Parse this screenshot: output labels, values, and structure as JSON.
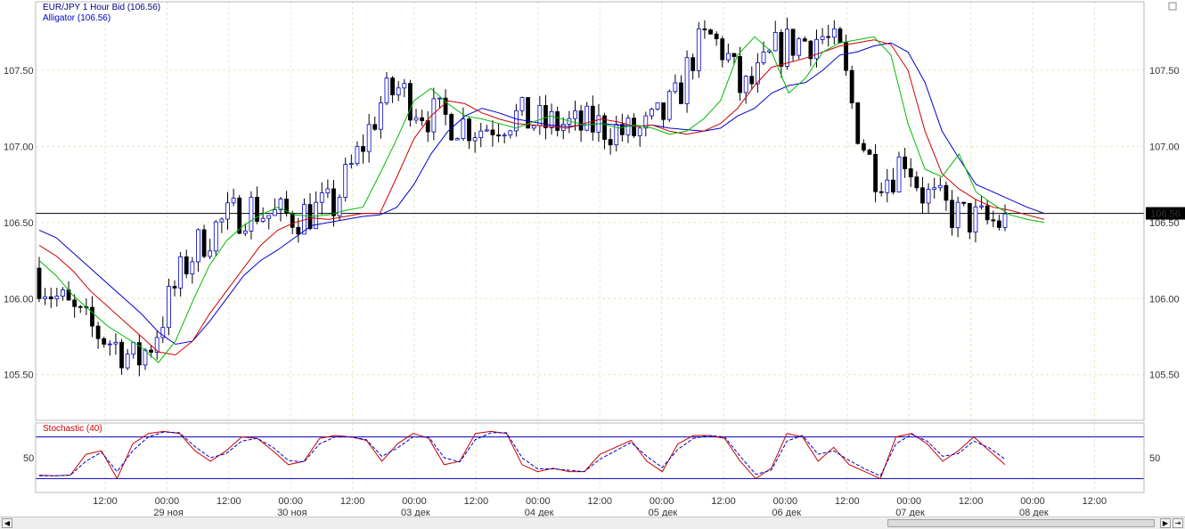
{
  "chart_data": [
    {
      "type": "candlestick",
      "title": "EUR/JPY 1 Hour Bid (106.56)",
      "subtitle": "Alligator (106.56)",
      "ylim": [
        105.2,
        107.95
      ],
      "yticks": [
        "105.50",
        "106.00",
        "106.50",
        "107.00",
        "107.50"
      ],
      "last_price": 106.56,
      "last_price_label": "106.56",
      "series": [
        {
          "name": "Jaw",
          "color": "#0000cc",
          "values": [
            106.45,
            106.4,
            106.3,
            106.2,
            106.1,
            106.0,
            105.9,
            105.78,
            105.7,
            105.72,
            105.85,
            106.0,
            106.15,
            106.25,
            106.32,
            106.4,
            106.48,
            106.5,
            106.52,
            106.54,
            106.55,
            106.6,
            106.75,
            106.95,
            107.1,
            107.2,
            107.25,
            107.22,
            107.18,
            107.16,
            107.14,
            107.13,
            107.14,
            107.15,
            107.14,
            107.13,
            107.14,
            107.12,
            107.11,
            107.1,
            107.12,
            107.2,
            107.25,
            107.35,
            107.4,
            107.42,
            107.5,
            107.6,
            107.62,
            107.66,
            107.68,
            107.62,
            107.42,
            107.1,
            106.92,
            106.75,
            106.7,
            106.65,
            106.6,
            106.56
          ]
        },
        {
          "name": "Teeth",
          "color": "#cc0000",
          "values": [
            106.35,
            106.28,
            106.18,
            106.05,
            105.95,
            105.85,
            105.75,
            105.65,
            105.63,
            105.72,
            105.9,
            106.05,
            106.2,
            106.35,
            106.45,
            106.5,
            106.53,
            106.52,
            106.54,
            106.56,
            106.56,
            106.8,
            107.05,
            107.2,
            107.3,
            107.28,
            107.22,
            107.18,
            107.15,
            107.14,
            107.13,
            107.12,
            107.15,
            107.18,
            107.16,
            107.13,
            107.14,
            107.1,
            107.08,
            107.1,
            107.15,
            107.25,
            107.4,
            107.52,
            107.55,
            107.58,
            107.62,
            107.66,
            107.68,
            107.7,
            107.67,
            107.5,
            107.1,
            106.82,
            106.72,
            106.65,
            106.6,
            106.58,
            106.55,
            106.52
          ]
        },
        {
          "name": "Lips",
          "color": "#00bb00",
          "values": [
            106.25,
            106.15,
            106.02,
            105.92,
            105.82,
            105.75,
            105.68,
            105.58,
            105.72,
            105.98,
            106.22,
            106.38,
            106.48,
            106.55,
            106.6,
            106.55,
            106.54,
            106.55,
            106.58,
            106.6,
            106.82,
            107.05,
            107.3,
            107.38,
            107.28,
            107.2,
            107.18,
            107.15,
            107.12,
            107.16,
            107.2,
            107.17,
            107.14,
            107.15,
            107.12,
            107.14,
            107.12,
            107.08,
            107.1,
            107.18,
            107.3,
            107.6,
            107.72,
            107.62,
            107.35,
            107.45,
            107.62,
            107.68,
            107.7,
            107.72,
            107.6,
            107.15,
            106.85,
            106.8,
            106.95,
            106.7,
            106.62,
            106.55,
            106.52,
            106.5
          ]
        }
      ]
    },
    {
      "type": "line",
      "title": "Stochastic (40)",
      "ytick_label": "50",
      "ylim": [
        0,
        100
      ],
      "levels": [
        80,
        20
      ],
      "series": [
        {
          "name": "%K",
          "color": "#cc0000",
          "values": [
            25,
            24,
            25,
            55,
            60,
            20,
            70,
            85,
            88,
            85,
            60,
            45,
            60,
            80,
            78,
            60,
            40,
            45,
            78,
            82,
            80,
            75,
            45,
            70,
            85,
            78,
            40,
            45,
            85,
            88,
            85,
            40,
            30,
            35,
            30,
            30,
            55,
            65,
            75,
            45,
            30,
            70,
            82,
            82,
            78,
            45,
            20,
            35,
            85,
            80,
            45,
            65,
            40,
            30,
            20,
            80,
            85,
            70,
            45,
            60,
            80,
            60,
            40
          ]
        },
        {
          "name": "%D",
          "color": "#0000cc",
          "values": [
            24,
            24,
            25,
            45,
            58,
            30,
            60,
            80,
            87,
            86,
            66,
            50,
            56,
            74,
            78,
            65,
            46,
            44,
            70,
            80,
            80,
            76,
            52,
            64,
            80,
            80,
            50,
            44,
            76,
            86,
            86,
            50,
            34,
            34,
            32,
            30,
            48,
            60,
            72,
            52,
            36,
            62,
            78,
            82,
            80,
            52,
            26,
            32,
            74,
            82,
            55,
            60,
            46,
            34,
            24,
            70,
            84,
            74,
            52,
            56,
            74,
            64,
            48
          ]
        }
      ]
    },
    {
      "type": "axis",
      "time_labels": [
        "12:00",
        "00:00",
        "12:00",
        "00:00",
        "12:00",
        "00:00",
        "12:00",
        "00:00",
        "12:00",
        "00:00",
        "12:00",
        "00:00",
        "12:00",
        "00:00",
        "12:00",
        "00:00",
        "12:00"
      ],
      "date_labels": [
        "29 ноя",
        "30 ноя",
        "03 дек",
        "04 дек",
        "05 дек",
        "06 дек",
        "07 дек",
        "08 дек"
      ]
    }
  ],
  "colors": {
    "grid": "#e6e6c6",
    "axis": "#b8b8b8",
    "level": "#0000bb"
  },
  "scroll": {
    "left_icon": "scroll-left-arrow-icon",
    "right_icon": "scroll-right-arrow-icon",
    "corner_icon": "corner-box-icon"
  }
}
